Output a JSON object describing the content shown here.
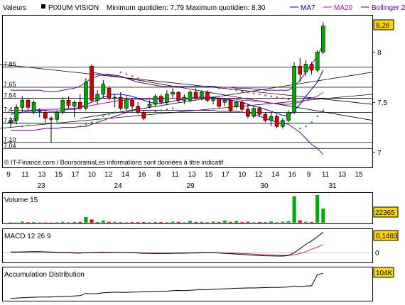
{
  "header": {
    "values_label": "Valeurs",
    "stock_name": "PIXIUM VISION",
    "min_max": "Minimum quotidien: 7,79 Maximum quotidien: 8,30",
    "legend": [
      {
        "label": "MA7",
        "color": "#0000cc"
      },
      {
        "label": "MA20",
        "color": "#cc00cc"
      },
      {
        "label": "Bollinger 2",
        "color": "#660099"
      }
    ]
  },
  "footer_text": "© IT-Finance.com / BoursoramaLes informations sont données à titre indicatif",
  "colors": {
    "up": "#00aa00",
    "down": "#dd0000",
    "ma7": "#0000cc",
    "ma20": "#cc00cc",
    "boll": "#660099",
    "psar_up": "#00aa00",
    "psar_down": "#cc3333",
    "grid": "#000000",
    "badge": "#ffd700"
  },
  "chart_data": [
    {
      "type": "candlestick",
      "panel": "price",
      "ylim": [
        6.95,
        8.35
      ],
      "right_ticks": [
        "8",
        "7,5",
        "7"
      ],
      "current_value": "8,26",
      "left_levels": [
        {
          "label": "7,85",
          "value": 7.85
        },
        {
          "label": "7,65",
          "value": 7.65
        },
        {
          "label": "7,54",
          "value": 7.54
        },
        {
          "label": "7,4",
          "value": 7.4
        },
        {
          "label": "7,29",
          "value": 7.29
        },
        {
          "label": "7,10",
          "value": 7.1
        },
        {
          "label": "7,04",
          "value": 7.04
        }
      ],
      "x_tick_labels": [
        "9",
        "11",
        "13",
        "15",
        "17",
        "10",
        "12",
        "14",
        "16",
        "8",
        "11",
        "13",
        "15",
        "17",
        "10",
        "12",
        "14",
        "16",
        "9",
        "11",
        "13",
        "15"
      ],
      "day_labels": [
        "23",
        "24",
        "29",
        "30",
        "31"
      ],
      "candles": [
        {
          "o": 7.3,
          "h": 7.35,
          "l": 7.25,
          "c": 7.32
        },
        {
          "o": 7.32,
          "h": 7.48,
          "l": 7.28,
          "c": 7.45
        },
        {
          "o": 7.45,
          "h": 7.56,
          "l": 7.4,
          "c": 7.52
        },
        {
          "o": 7.52,
          "h": 7.54,
          "l": 7.42,
          "c": 7.45
        },
        {
          "o": 7.4,
          "h": 7.52,
          "l": 7.38,
          "c": 7.5
        },
        {
          "o": 7.4,
          "h": 7.44,
          "l": 7.35,
          "c": 7.41
        },
        {
          "o": 7.4,
          "h": 7.42,
          "l": 7.3,
          "c": 7.34
        },
        {
          "o": 7.34,
          "h": 7.36,
          "l": 7.1,
          "c": 7.33
        },
        {
          "o": 7.33,
          "h": 7.42,
          "l": 7.3,
          "c": 7.4
        },
        {
          "o": 7.4,
          "h": 7.55,
          "l": 7.38,
          "c": 7.52
        },
        {
          "o": 7.52,
          "h": 7.56,
          "l": 7.44,
          "c": 7.47
        },
        {
          "o": 7.46,
          "h": 7.52,
          "l": 7.35,
          "c": 7.5
        },
        {
          "o": 7.5,
          "h": 7.58,
          "l": 7.42,
          "c": 7.44
        },
        {
          "o": 7.44,
          "h": 7.74,
          "l": 7.42,
          "c": 7.7
        },
        {
          "o": 7.86,
          "h": 7.88,
          "l": 7.5,
          "c": 7.52
        },
        {
          "o": 7.52,
          "h": 7.62,
          "l": 7.48,
          "c": 7.58
        },
        {
          "o": 7.58,
          "h": 7.72,
          "l": 7.55,
          "c": 7.68
        },
        {
          "o": 7.64,
          "h": 7.66,
          "l": 7.52,
          "c": 7.54
        },
        {
          "o": 7.54,
          "h": 7.58,
          "l": 7.45,
          "c": 7.55
        },
        {
          "o": 7.55,
          "h": 7.6,
          "l": 7.42,
          "c": 7.44
        },
        {
          "o": 7.44,
          "h": 7.56,
          "l": 7.42,
          "c": 7.53
        },
        {
          "o": 7.52,
          "h": 7.54,
          "l": 7.4,
          "c": 7.46
        },
        {
          "o": 7.46,
          "h": 7.5,
          "l": 7.38,
          "c": 7.4
        },
        {
          "o": 7.4,
          "h": 7.42,
          "l": 7.32,
          "c": 7.34
        },
        {
          "o": 7.46,
          "h": 7.52,
          "l": 7.44,
          "c": 7.48
        },
        {
          "o": 7.48,
          "h": 7.58,
          "l": 7.46,
          "c": 7.56
        },
        {
          "o": 7.56,
          "h": 7.58,
          "l": 7.48,
          "c": 7.5
        },
        {
          "o": 7.5,
          "h": 7.62,
          "l": 7.48,
          "c": 7.58
        },
        {
          "o": 7.58,
          "h": 7.64,
          "l": 7.54,
          "c": 7.6
        },
        {
          "o": 7.6,
          "h": 7.61,
          "l": 7.5,
          "c": 7.52
        },
        {
          "o": 7.52,
          "h": 7.58,
          "l": 7.48,
          "c": 7.55
        },
        {
          "o": 7.52,
          "h": 7.62,
          "l": 7.5,
          "c": 7.6
        },
        {
          "o": 7.6,
          "h": 7.64,
          "l": 7.52,
          "c": 7.54
        },
        {
          "o": 7.54,
          "h": 7.62,
          "l": 7.52,
          "c": 7.6
        },
        {
          "o": 7.6,
          "h": 7.62,
          "l": 7.5,
          "c": 7.52
        },
        {
          "o": 7.52,
          "h": 7.56,
          "l": 7.48,
          "c": 7.54
        },
        {
          "o": 7.54,
          "h": 7.55,
          "l": 7.44,
          "c": 7.46
        },
        {
          "o": 7.5,
          "h": 7.54,
          "l": 7.46,
          "c": 7.52
        },
        {
          "o": 7.52,
          "h": 7.53,
          "l": 7.4,
          "c": 7.42
        },
        {
          "o": 7.46,
          "h": 7.52,
          "l": 7.44,
          "c": 7.5
        },
        {
          "o": 7.5,
          "h": 7.52,
          "l": 7.4,
          "c": 7.43
        },
        {
          "o": 7.43,
          "h": 7.48,
          "l": 7.34,
          "c": 7.36
        },
        {
          "o": 7.36,
          "h": 7.46,
          "l": 7.34,
          "c": 7.44
        },
        {
          "o": 7.44,
          "h": 7.46,
          "l": 7.36,
          "c": 7.38
        },
        {
          "o": 7.38,
          "h": 7.4,
          "l": 7.3,
          "c": 7.32
        },
        {
          "o": 7.32,
          "h": 7.4,
          "l": 7.26,
          "c": 7.36
        },
        {
          "o": 7.36,
          "h": 7.38,
          "l": 7.24,
          "c": 7.26
        },
        {
          "o": 7.26,
          "h": 7.34,
          "l": 7.24,
          "c": 7.32
        },
        {
          "o": 7.32,
          "h": 7.42,
          "l": 7.3,
          "c": 7.4
        },
        {
          "o": 7.4,
          "h": 7.9,
          "l": 7.38,
          "c": 7.86
        },
        {
          "o": 7.86,
          "h": 7.94,
          "l": 7.7,
          "c": 7.78
        },
        {
          "o": 7.8,
          "h": 7.92,
          "l": 7.76,
          "c": 7.88
        },
        {
          "o": 7.88,
          "h": 7.9,
          "l": 7.78,
          "c": 7.82
        },
        {
          "o": 7.82,
          "h": 8.02,
          "l": 7.8,
          "c": 8.0
        },
        {
          "o": 8.0,
          "h": 8.3,
          "l": 7.98,
          "c": 8.26
        }
      ],
      "ma7": [
        7.38,
        7.39,
        7.4,
        7.41,
        7.42,
        7.42,
        7.42,
        7.41,
        7.41,
        7.42,
        7.43,
        7.43,
        7.44,
        7.48,
        7.5,
        7.52,
        7.55,
        7.57,
        7.58,
        7.58,
        7.57,
        7.56,
        7.54,
        7.52,
        7.5,
        7.49,
        7.49,
        7.5,
        7.51,
        7.52,
        7.53,
        7.54,
        7.55,
        7.55,
        7.55,
        7.55,
        7.54,
        7.53,
        7.52,
        7.51,
        7.5,
        7.48,
        7.46,
        7.45,
        7.43,
        7.41,
        7.39,
        7.37,
        7.36,
        7.42,
        7.48,
        7.56,
        7.63,
        7.7,
        7.82
      ],
      "ma20": [
        7.42,
        7.42,
        7.42,
        7.42,
        7.42,
        7.43,
        7.43,
        7.43,
        7.43,
        7.44,
        7.44,
        7.44,
        7.45,
        7.46,
        7.47,
        7.48,
        7.49,
        7.5,
        7.51,
        7.52,
        7.52,
        7.53,
        7.53,
        7.53,
        7.53,
        7.53,
        7.53,
        7.54,
        7.54,
        7.54,
        7.54,
        7.54,
        7.54,
        7.54,
        7.54,
        7.54,
        7.53,
        7.53,
        7.53,
        7.53,
        7.52,
        7.52,
        7.51,
        7.51,
        7.5,
        7.49,
        7.49,
        7.48,
        7.48,
        7.49,
        7.5,
        7.52,
        7.54,
        7.56,
        7.6
      ],
      "boll_upper": [
        7.62,
        7.62,
        7.62,
        7.62,
        7.62,
        7.62,
        7.61,
        7.61,
        7.61,
        7.62,
        7.63,
        7.64,
        7.66,
        7.7,
        7.74,
        7.76,
        7.78,
        7.78,
        7.77,
        7.76,
        7.74,
        7.72,
        7.7,
        7.69,
        7.68,
        7.67,
        7.66,
        7.66,
        7.66,
        7.66,
        7.66,
        7.66,
        7.66,
        7.66,
        7.66,
        7.66,
        7.65,
        7.65,
        7.65,
        7.64,
        7.64,
        7.64,
        7.63,
        7.63,
        7.62,
        7.62,
        7.62,
        7.62,
        7.62,
        7.66,
        7.72,
        7.8,
        7.88,
        7.96,
        8.08
      ],
      "boll_lower": [
        7.22,
        7.22,
        7.22,
        7.22,
        7.22,
        7.23,
        7.24,
        7.24,
        7.24,
        7.25,
        7.25,
        7.25,
        7.26,
        7.26,
        7.28,
        7.3,
        7.32,
        7.34,
        7.36,
        7.38,
        7.4,
        7.42,
        7.42,
        7.42,
        7.42,
        7.42,
        7.42,
        7.42,
        7.42,
        7.42,
        7.42,
        7.42,
        7.42,
        7.42,
        7.42,
        7.42,
        7.41,
        7.41,
        7.41,
        7.41,
        7.4,
        7.4,
        7.38,
        7.36,
        7.34,
        7.32,
        7.3,
        7.29,
        7.28,
        7.24,
        7.2,
        7.14,
        7.08,
        7.04,
        6.98
      ],
      "psar": [
        {
          "i": 2,
          "v": 7.26,
          "up": true
        },
        {
          "i": 3,
          "v": 7.27,
          "up": true
        },
        {
          "i": 12,
          "v": 7.26,
          "up": true
        },
        {
          "i": 13,
          "v": 7.28,
          "up": true
        },
        {
          "i": 14,
          "v": 7.3,
          "up": true
        },
        {
          "i": 15,
          "v": 7.33,
          "up": true
        },
        {
          "i": 16,
          "v": 7.36,
          "up": true
        },
        {
          "i": 17,
          "v": 7.38,
          "up": true
        },
        {
          "i": 18,
          "v": 7.4,
          "up": true
        },
        {
          "i": 19,
          "v": 7.8,
          "up": false
        },
        {
          "i": 20,
          "v": 7.78,
          "up": false
        },
        {
          "i": 21,
          "v": 7.76,
          "up": false
        },
        {
          "i": 22,
          "v": 7.74,
          "up": false
        },
        {
          "i": 23,
          "v": 7.72,
          "up": false
        },
        {
          "i": 24,
          "v": 7.4,
          "up": true
        },
        {
          "i": 25,
          "v": 7.41,
          "up": true
        },
        {
          "i": 26,
          "v": 7.42,
          "up": true
        },
        {
          "i": 27,
          "v": 7.43,
          "up": true
        },
        {
          "i": 28,
          "v": 7.44,
          "up": true
        },
        {
          "i": 36,
          "v": 7.64,
          "up": false
        },
        {
          "i": 37,
          "v": 7.64,
          "up": false
        },
        {
          "i": 38,
          "v": 7.63,
          "up": false
        },
        {
          "i": 39,
          "v": 7.62,
          "up": false
        },
        {
          "i": 40,
          "v": 7.61,
          "up": false
        },
        {
          "i": 41,
          "v": 7.6,
          "up": false
        },
        {
          "i": 42,
          "v": 7.59,
          "up": false
        },
        {
          "i": 43,
          "v": 7.58,
          "up": false
        },
        {
          "i": 44,
          "v": 7.57,
          "up": false
        },
        {
          "i": 45,
          "v": 7.56,
          "up": false
        },
        {
          "i": 46,
          "v": 7.55,
          "up": false
        },
        {
          "i": 47,
          "v": 7.54,
          "up": false
        },
        {
          "i": 48,
          "v": 7.53,
          "up": false
        },
        {
          "i": 50,
          "v": 7.24,
          "up": true
        },
        {
          "i": 51,
          "v": 7.26,
          "up": true
        },
        {
          "i": 52,
          "v": 7.3,
          "up": true
        },
        {
          "i": 53,
          "v": 7.36,
          "up": true
        },
        {
          "i": 54,
          "v": 7.42,
          "up": true
        }
      ],
      "trendlines": [
        {
          "a": {
            "i": -2,
            "v": 7.88
          },
          "b": {
            "i": 80,
            "v": 7.48
          }
        },
        {
          "a": {
            "i": 12,
            "v": 7.34
          },
          "b": {
            "i": 80,
            "v": 7.8
          }
        },
        {
          "a": {
            "i": -2,
            "v": 7.24
          },
          "b": {
            "i": 80,
            "v": 7.58
          }
        },
        {
          "a": {
            "i": 14,
            "v": 7.8
          },
          "b": {
            "i": 80,
            "v": 7.32
          }
        }
      ]
    },
    {
      "type": "bar",
      "panel": "volume",
      "title": "Volume 15",
      "current_value": "22365",
      "ylim": [
        0,
        45000
      ],
      "values": [
        800,
        600,
        1800,
        900,
        1200,
        700,
        600,
        500,
        900,
        1500,
        700,
        1400,
        1300,
        9000,
        5000,
        1200,
        3200,
        1400,
        1500,
        900,
        800,
        1100,
        900,
        1200,
        800,
        1300,
        1100,
        900,
        1700,
        1400,
        700,
        2800,
        1200,
        1500,
        800,
        1800,
        1100,
        3400,
        1400,
        2800,
        1000,
        1600,
        800,
        1300,
        900,
        2100,
        700,
        1600,
        2200,
        42000,
        3600,
        1500,
        1200,
        44000,
        22365
      ]
    },
    {
      "type": "line",
      "panel": "macd",
      "title": "MACD 12 26 9",
      "current_value": "0,1483",
      "ytick": "0",
      "ylim": [
        -0.06,
        0.16
      ],
      "macd": [
        0.005,
        0.005,
        0.006,
        0.007,
        0.008,
        0.008,
        0.006,
        0.004,
        0.002,
        0.001,
        0.0,
        -0.002,
        -0.003,
        0.0,
        0.002,
        0.003,
        0.004,
        0.004,
        0.003,
        0.002,
        0.001,
        0.0,
        -0.002,
        -0.004,
        -0.005,
        -0.006,
        -0.006,
        -0.005,
        -0.004,
        -0.003,
        -0.002,
        -0.001,
        0.0,
        0.001,
        0.001,
        0.0,
        -0.002,
        -0.004,
        -0.007,
        -0.01,
        -0.013,
        -0.016,
        -0.018,
        -0.02,
        -0.022,
        -0.023,
        -0.024,
        -0.024,
        -0.02,
        0.0,
        0.03,
        0.06,
        0.085,
        0.115,
        0.148
      ],
      "signal": [
        0.004,
        0.004,
        0.004,
        0.005,
        0.005,
        0.006,
        0.006,
        0.005,
        0.004,
        0.003,
        0.002,
        0.001,
        0.0,
        0.0,
        0.0,
        0.001,
        0.001,
        0.002,
        0.002,
        0.002,
        0.002,
        0.001,
        0.0,
        -0.001,
        -0.002,
        -0.003,
        -0.004,
        -0.004,
        -0.004,
        -0.004,
        -0.004,
        -0.003,
        -0.002,
        -0.001,
        0.0,
        0.0,
        -0.001,
        -0.002,
        -0.003,
        -0.004,
        -0.006,
        -0.008,
        -0.01,
        -0.012,
        -0.014,
        -0.016,
        -0.018,
        -0.019,
        -0.019,
        -0.015,
        -0.006,
        0.008,
        0.025,
        0.04,
        0.058
      ]
    },
    {
      "type": "line",
      "panel": "accumulation",
      "title": "Accumulation Distribution",
      "current_value": "104K",
      "ylim": [
        -5000,
        125000
      ],
      "values": [
        2000,
        3000,
        4500,
        5500,
        6500,
        7000,
        7000,
        7500,
        8500,
        9500,
        10000,
        11500,
        13000,
        22000,
        20000,
        21500,
        24500,
        25500,
        27000,
        26500,
        26000,
        27500,
        28000,
        29000,
        28500,
        30000,
        30500,
        31000,
        33000,
        34000,
        33500,
        35000,
        36000,
        37500,
        37000,
        38500,
        39500,
        41000,
        41500,
        43000,
        43500,
        44500,
        44000,
        45000,
        45500,
        46500,
        46000,
        47000,
        48500,
        52000,
        50000,
        52000,
        53000,
        98000,
        104000
      ]
    }
  ]
}
